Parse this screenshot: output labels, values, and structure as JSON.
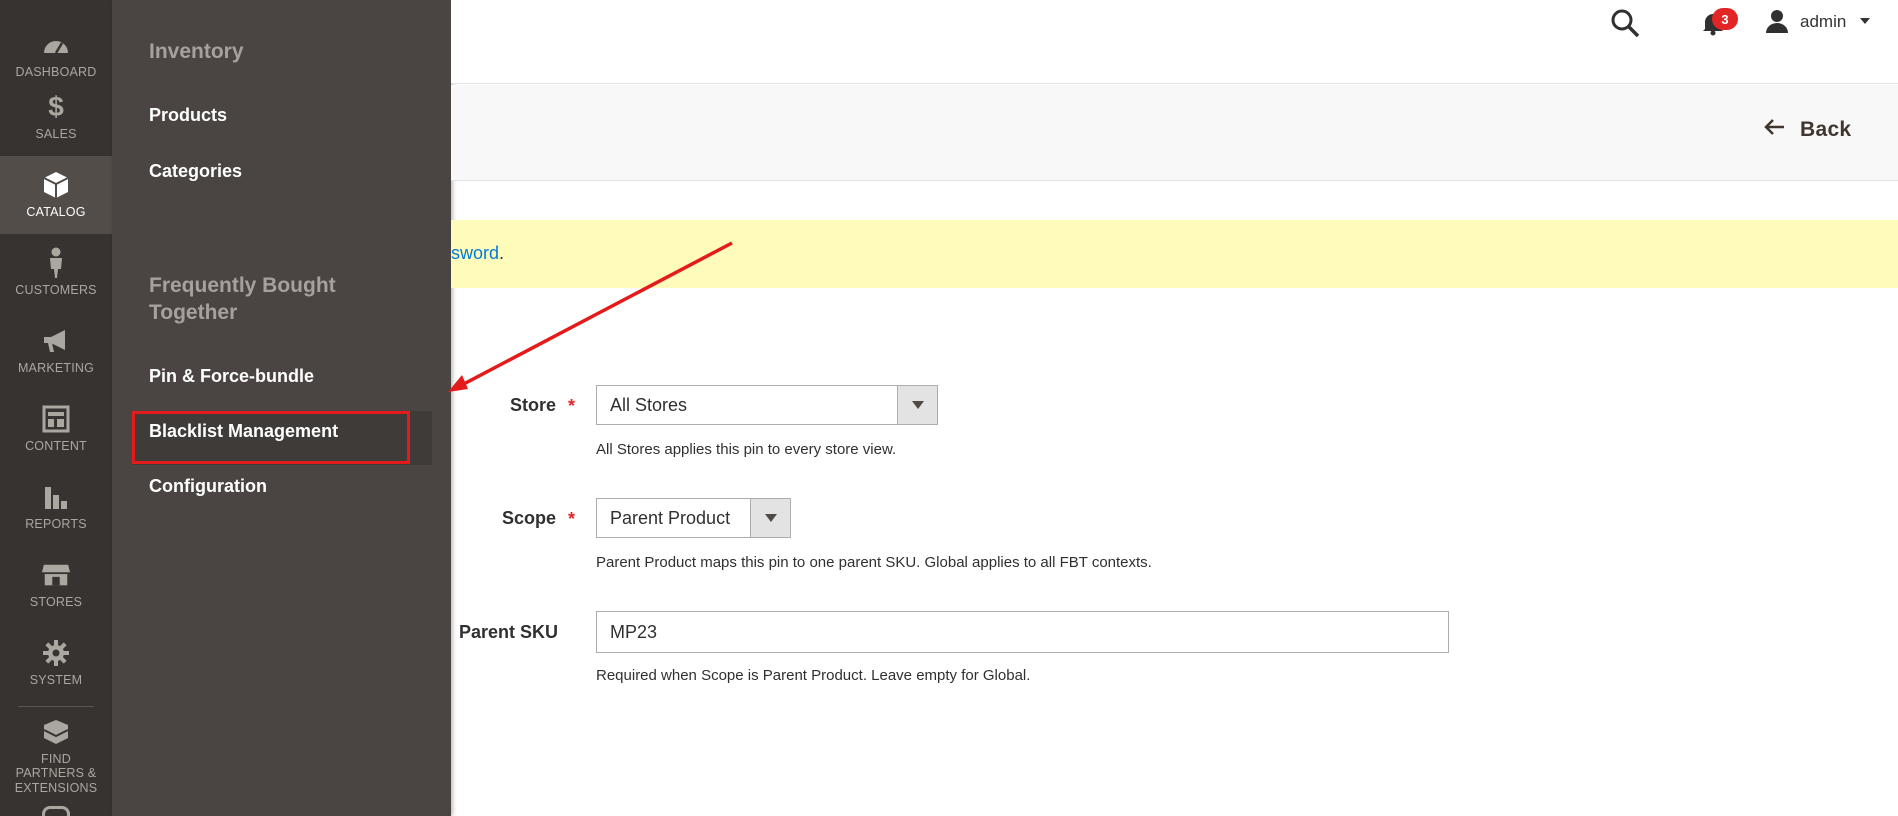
{
  "side_nav": {
    "items": [
      {
        "label": "DASHBOARD",
        "icon": "dashboard-icon"
      },
      {
        "label": "SALES",
        "icon": "dollar-icon"
      },
      {
        "label": "CATALOG",
        "icon": "cube-icon",
        "active": true
      },
      {
        "label": "CUSTOMERS",
        "icon": "person-icon"
      },
      {
        "label": "MARKETING",
        "icon": "megaphone-icon"
      },
      {
        "label": "CONTENT",
        "icon": "layout-icon"
      },
      {
        "label": "REPORTS",
        "icon": "bar-chart-icon"
      },
      {
        "label": "STORES",
        "icon": "storefront-icon"
      },
      {
        "label": "SYSTEM",
        "icon": "gear-icon"
      },
      {
        "label": "FIND PARTNERS & EXTENSIONS",
        "icon": "blocks-icon"
      }
    ]
  },
  "flyout": {
    "group1_title": "Inventory",
    "products": "Products",
    "categories": "Categories",
    "group2_title": "Frequently Bought Together",
    "pin_force": "Pin & Force-bundle",
    "blacklist": "Blacklist Management",
    "configuration": "Configuration"
  },
  "header": {
    "notification_count": "3",
    "user": "admin"
  },
  "actions": {
    "back": "Back"
  },
  "message": {
    "link_text": "sword",
    "tail": "."
  },
  "form": {
    "store_label": "Store",
    "store_value": "All Stores",
    "store_note": "All Stores applies this pin to every store view.",
    "scope_label": "Scope",
    "scope_value": "Parent Product",
    "scope_note": "Parent Product maps this pin to one parent SKU. Global applies to all FBT contexts.",
    "parent_sku_label": "Parent SKU",
    "parent_sku_value": "MP23",
    "parent_sku_note": "Required when Scope is Parent Product. Leave empty for Global.",
    "required_mark": "*"
  },
  "colors": {
    "nav_bg": "#373330",
    "flyout_bg": "#4a4542",
    "highlight_red": "#e41b1b",
    "message_bg": "#fffbbb",
    "link_blue": "#007bdb"
  }
}
